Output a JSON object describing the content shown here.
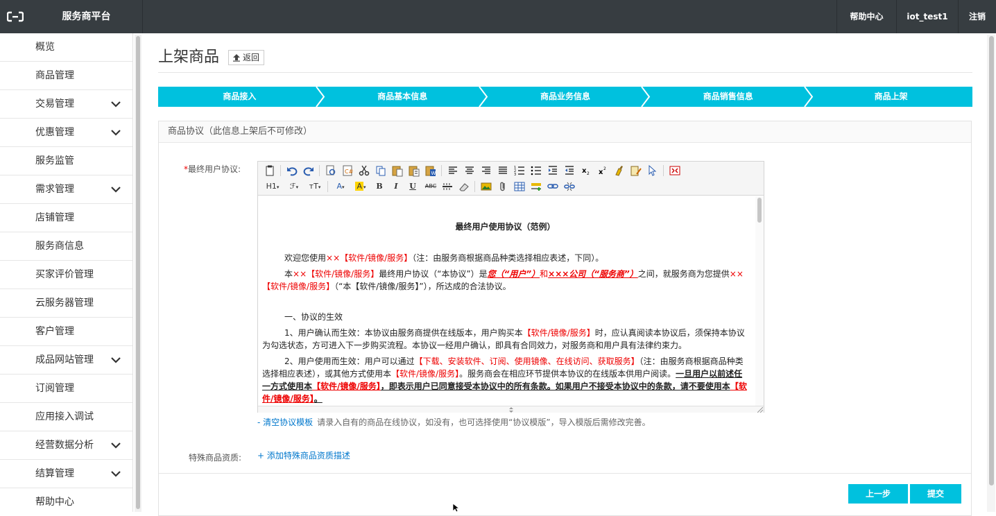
{
  "topbar": {
    "brand": "服务商平台",
    "help": "帮助中心",
    "user": "iot_test1",
    "logout": "注销"
  },
  "sidebar": {
    "items": [
      {
        "label": "概览",
        "expandable": false
      },
      {
        "label": "商品管理",
        "expandable": false
      },
      {
        "label": "交易管理",
        "expandable": true
      },
      {
        "label": "优惠管理",
        "expandable": true
      },
      {
        "label": "服务监管",
        "expandable": false
      },
      {
        "label": "需求管理",
        "expandable": true
      },
      {
        "label": "店铺管理",
        "expandable": false
      },
      {
        "label": "服务商信息",
        "expandable": false
      },
      {
        "label": "买家评价管理",
        "expandable": false
      },
      {
        "label": "云服务器管理",
        "expandable": false
      },
      {
        "label": "客户管理",
        "expandable": false
      },
      {
        "label": "成品网站管理",
        "expandable": true
      },
      {
        "label": "订阅管理",
        "expandable": false
      },
      {
        "label": "应用接入调试",
        "expandable": false
      },
      {
        "label": "经营数据分析",
        "expandable": true
      },
      {
        "label": "结算管理",
        "expandable": true
      },
      {
        "label": "帮助中心",
        "expandable": false
      }
    ]
  },
  "page": {
    "title": "上架商品",
    "back": "返回"
  },
  "steps": [
    "商品接入",
    "商品基本信息",
    "商品业务信息",
    "商品销售信息",
    "商品上架"
  ],
  "panel": {
    "title": "商品协议（此信息上架后不可修改）"
  },
  "form": {
    "agreement_label": "最终用户协议:",
    "required_mark": "*",
    "special_label": "特殊商品资质:",
    "clear_link": "- 清空协议模板",
    "hint": "请录入自有的商品在线协议，如没有，也可选择使用“协议模版”，导入模版后需修改完善。",
    "add_link": "+ 添加特殊商品资质描述"
  },
  "toolbar": {
    "h1": "H1",
    "font": "ℱ",
    "size": "тT",
    "color": "A",
    "bg": "A",
    "bold": "B",
    "italic": "I",
    "underline": "U",
    "strike": "ABC"
  },
  "doc": {
    "title": "最终用户使用协议（范例）",
    "p1": {
      "a": "欢迎您使用",
      "b": "××【软件/镜像/服务】",
      "c": "（注：由服务商根据商品种类选择相应表述，下同）。"
    },
    "p2": {
      "a": "本",
      "b": "××【软件/镜像/服务】",
      "c": "最终用户协议（“本协议”）是",
      "d": "您（“用户”）",
      "e": "和",
      "f": "×××公司（“服务商”）",
      "g": "之间，就服务商为您提供",
      "h": "××【软件/镜像/服务】",
      "i": "（“本【软件/镜像/服务】”），所达成的合法协议。"
    },
    "s1": "一、协议的生效",
    "p3": {
      "a": "1、用户确认而生效：本协议由服务商提供在线版本，用户购买本",
      "b": "【软件/镜像/服务】",
      "c": "时，应认真阅读本协议后，须保持本协议为勾选状态，方可进入下一步购买流程。本协议一经用户确认，即具有合同效力，对服务商和用户具有法律约束力。"
    },
    "p4": {
      "a": "2、用户使用而生效：用户可以通过",
      "b": "【下载、安装软件、订阅、使用镜像、在线访问、获取服务】",
      "c": "（注：由服务商根据商品种类选择相应表述），或其他方式使用本",
      "d": "【软件/镜像/服务】",
      "e": "。服务商会在相应环节提供本协议的在线版本供用户阅读。",
      "f": "一旦用户以前述任一方式使用本",
      "g": "【软件/镜像/服务】",
      "h": "，即表示用户已同意接受本协议中的所有条款。如果用户不接受本协议中的条款，请不要使用本",
      "i": "【软件/镜像/服务】",
      "j": "。"
    }
  },
  "buttons": {
    "prev": "上一步",
    "submit": "提交"
  },
  "colors": {
    "accent": "#00c1de",
    "topbar": "#373d41",
    "link": "#0077cc",
    "highlight_red": "#e00000"
  }
}
